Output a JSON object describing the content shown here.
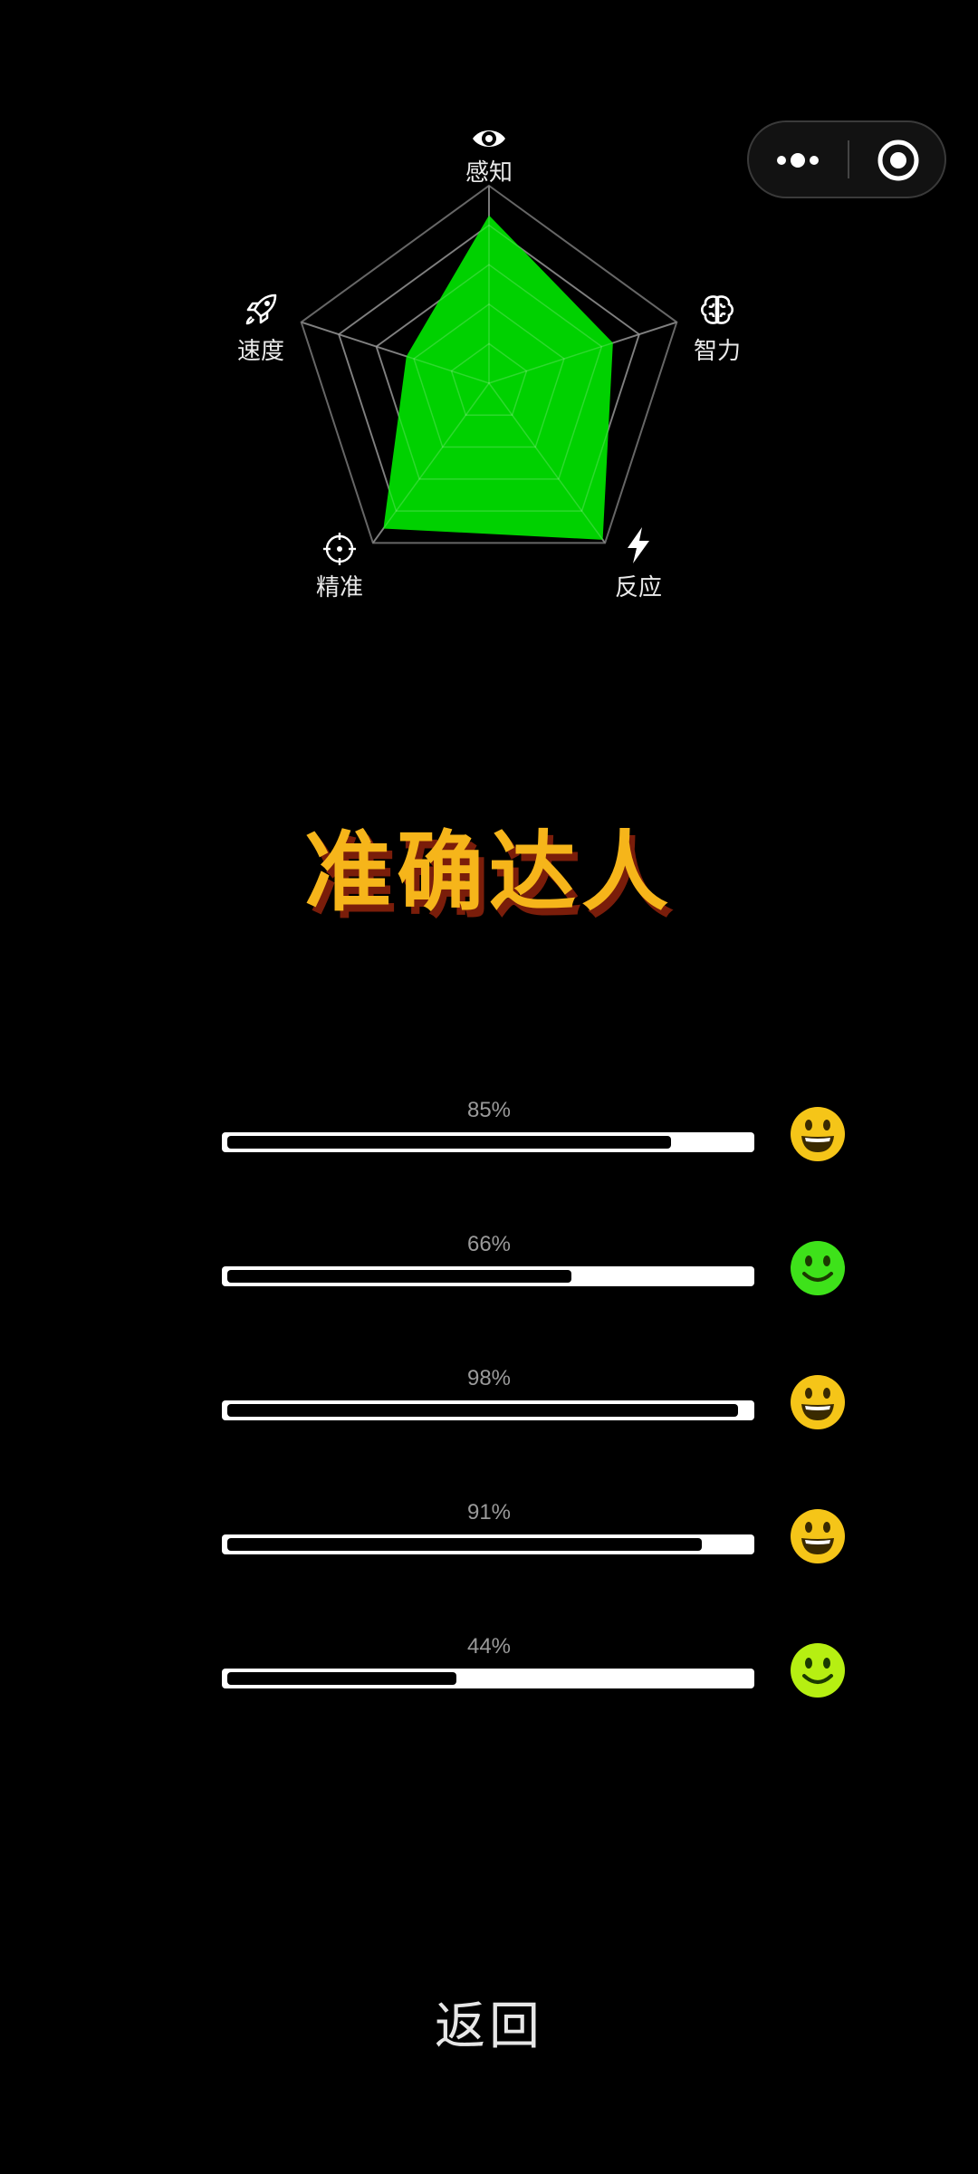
{
  "radar": {
    "axes": [
      {
        "label": "感知",
        "icon": "eye-icon",
        "value": 0.85
      },
      {
        "label": "智力",
        "icon": "brain-icon",
        "value": 0.66
      },
      {
        "label": "反应",
        "icon": "lightning-icon",
        "value": 0.98
      },
      {
        "label": "精准",
        "icon": "crosshair-icon",
        "value": 0.91
      },
      {
        "label": "速度",
        "icon": "rocket-icon",
        "value": 0.44
      }
    ],
    "fill_color": "#00d100",
    "grid_color": "#666666",
    "max": 1
  },
  "title": "准确达人",
  "progress": [
    {
      "label": "85%",
      "value": 0.85,
      "face": "laughing-face-icon",
      "face_color": "#f5c518"
    },
    {
      "label": "66%",
      "value": 0.66,
      "face": "smiling-face-icon",
      "face_color": "#3ee21a"
    },
    {
      "label": "98%",
      "value": 0.98,
      "face": "laughing-face-icon",
      "face_color": "#f5c518"
    },
    {
      "label": "91%",
      "value": 0.91,
      "face": "laughing-face-icon",
      "face_color": "#f5c518"
    },
    {
      "label": "44%",
      "value": 0.44,
      "face": "smiling-face-icon",
      "face_color": "#b6ef12"
    }
  ],
  "back_label": "返回"
}
